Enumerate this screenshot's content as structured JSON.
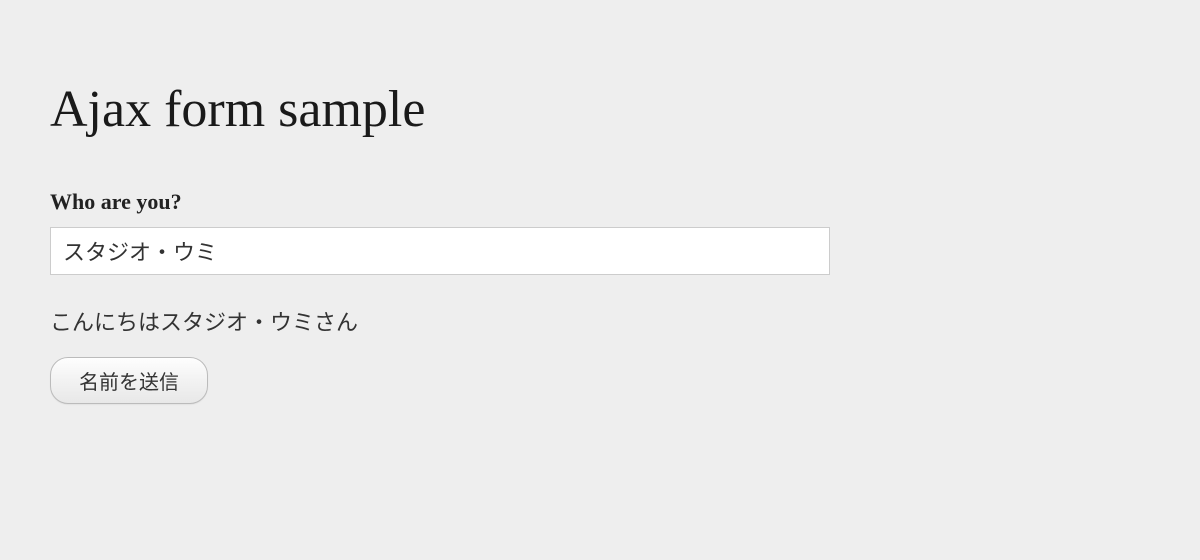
{
  "page": {
    "title": "Ajax form sample"
  },
  "form": {
    "label": "Who are you?",
    "input_value": "スタジオ・ウミ",
    "greeting": "こんにちはスタジオ・ウミさん",
    "submit_label": "名前を送信"
  }
}
